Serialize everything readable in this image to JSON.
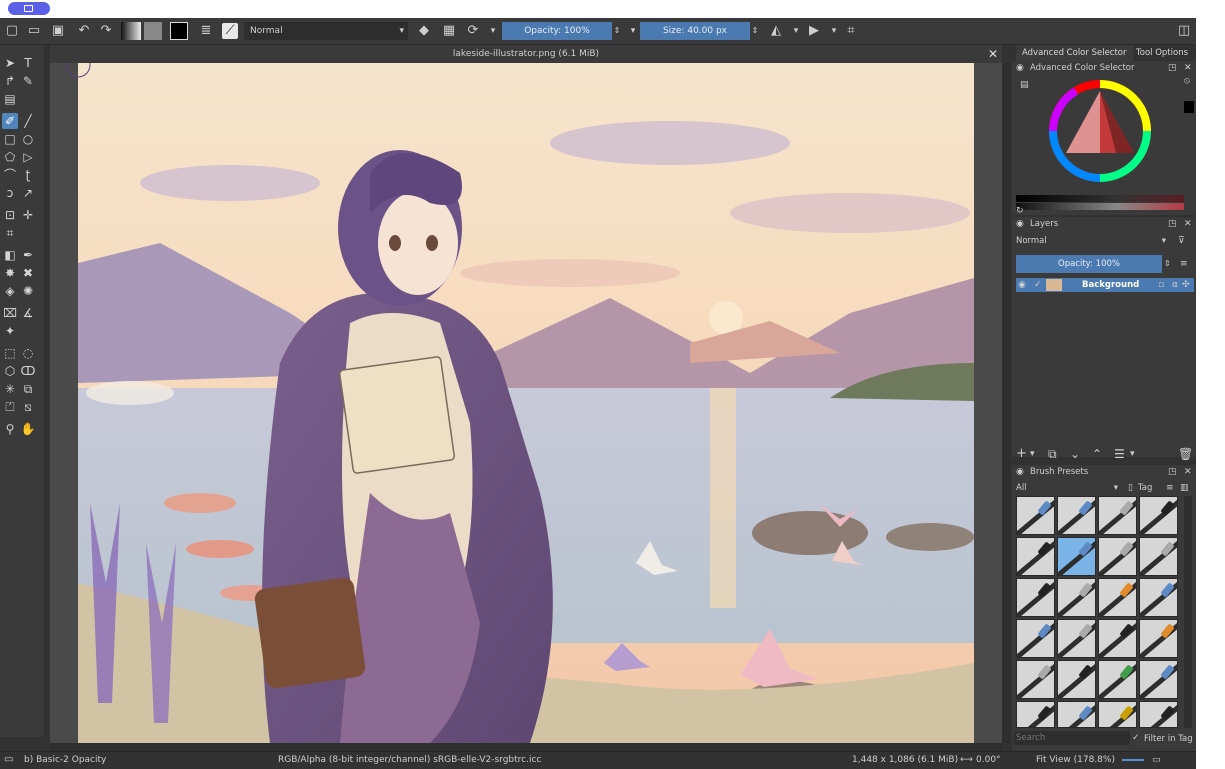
{
  "toolbar": {
    "blend_mode": "Normal",
    "opacity_label": "Opacity: 100%",
    "size_label": "Size: 40.00 px"
  },
  "document": {
    "title": "lakeside-illustrator.png (6.1 MiB)"
  },
  "dockers": {
    "tabs": [
      "Advanced Color Selector",
      "Tool Options"
    ],
    "color_selector_title": "Advanced Color Selector",
    "layers": {
      "title": "Layers",
      "blend_mode": "Normal",
      "opacity": "Opacity: 100%",
      "items": [
        {
          "name": "Background"
        }
      ]
    },
    "brush_presets": {
      "title": "Brush Presets",
      "filter": "All",
      "tag_label": "Tag",
      "search_placeholder": "Search",
      "filter_in_tag": "Filter in Tag"
    }
  },
  "status": {
    "brush": "b) Basic-2 Opacity",
    "color_space": "RGB/Alpha (8-bit integer/channel)  sRGB-elle-V2-srgbtrc.icc",
    "image_size": "1,448 x 1,086 (6.1 MiB)",
    "rotation": "0.00°",
    "zoom": "Fit View (178.8%)"
  },
  "colors": {
    "accent": "#4a7ab0",
    "panel": "#3a3a3a",
    "background": "#323232"
  }
}
